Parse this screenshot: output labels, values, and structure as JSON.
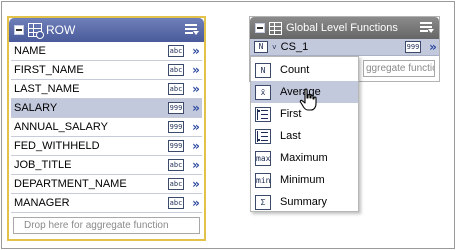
{
  "row_panel": {
    "title": "ROW",
    "columns": [
      {
        "name": "NAME",
        "type": "abc",
        "selected": false
      },
      {
        "name": "FIRST_NAME",
        "type": "abc",
        "selected": false
      },
      {
        "name": "LAST_NAME",
        "type": "abc",
        "selected": false
      },
      {
        "name": "SALARY",
        "type": "999",
        "selected": true
      },
      {
        "name": "ANNUAL_SALARY",
        "type": "999",
        "selected": false
      },
      {
        "name": "FED_WITHHELD",
        "type": "999",
        "selected": false
      },
      {
        "name": "JOB_TITLE",
        "type": "abc",
        "selected": false
      },
      {
        "name": "DEPARTMENT_NAME",
        "type": "abc",
        "selected": false
      },
      {
        "name": "MANAGER",
        "type": "abc",
        "selected": false
      }
    ],
    "drop_placeholder": "Drop here for aggregate function",
    "border_color": "#e3c24a",
    "header_color": "#5a6aa8"
  },
  "glf_panel": {
    "title": "Global Level Functions",
    "column": {
      "name": "CS_1",
      "badge": "N",
      "type": "999"
    },
    "drop_placeholder": "ggregate function",
    "header_color": "#777777"
  },
  "function_menu": {
    "items": [
      {
        "label": "Count",
        "icon": "N",
        "hover": false
      },
      {
        "label": "Average",
        "icon": "x̄",
        "hover": true
      },
      {
        "label": "First",
        "icon": "first-icon",
        "hover": false
      },
      {
        "label": "Last",
        "icon": "last-icon",
        "hover": false
      },
      {
        "label": "Maximum",
        "icon": "max",
        "hover": false
      },
      {
        "label": "Minimum",
        "icon": "min",
        "hover": false
      },
      {
        "label": "Summary",
        "icon": "Σ",
        "hover": false
      }
    ],
    "highlight_color": "#c3c9dc"
  },
  "glyphs": {
    "chevron": "»",
    "caret": "˅"
  }
}
